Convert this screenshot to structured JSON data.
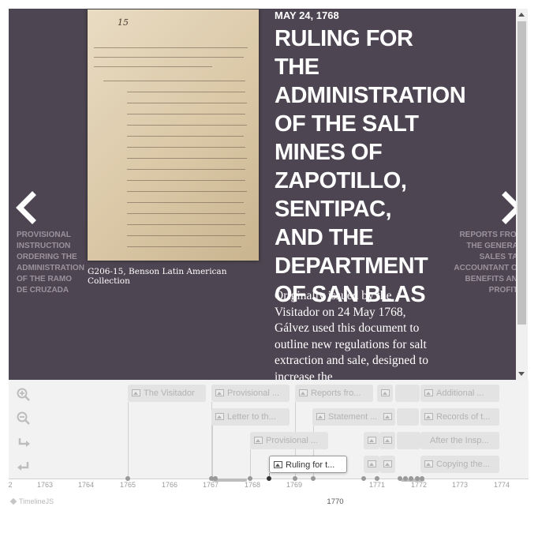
{
  "slide": {
    "date": "MAY 24, 1768",
    "headline": "RULING FOR THE ADMINISTRATION OF THE SALT MINES OF ZAPOTILLO, SENTIPAC, AND THE DEPARTMENT OF SAN BLAS",
    "body": "Originally issued by the Visitador on 24 May 1768, Gálvez used this document to outline new regulations for salt extraction and sale, designed to increase the",
    "media_caption": "G206-15, Benson Latin American Collection",
    "media_page_number": "15",
    "prev_label": "PROVISIONAL INSTRUCTION ORDERING THE ADMINISTRATION OF THE RAMO DE CRUZADA",
    "next_label": "REPORTS FROM THE GENERAL SALES TAX ACCOUNTANT ON BENEFITS AND PROFITS",
    "background_color": "#4d4551"
  },
  "icons": {
    "prev": "chevron-left-icon",
    "next": "chevron-right-icon",
    "zoom_in": "zoom-in-icon",
    "zoom_out": "zoom-out-icon",
    "undo": "undo-icon",
    "redo": "redo-icon",
    "marker_image": "image-icon"
  },
  "timenav": {
    "markers": [
      {
        "label": "The Visitador"
      },
      {
        "label": "Provisional ..."
      },
      {
        "label": "Reports fro..."
      },
      {
        "label": "Additional ..."
      },
      {
        "label": "Letter to th..."
      },
      {
        "label": "Statement ..."
      },
      {
        "label": "Records of t..."
      },
      {
        "label": "Provisional ..."
      },
      {
        "label": "After the Insp..."
      },
      {
        "label": "Ruling for t..."
      },
      {
        "label": "Copying the..."
      }
    ],
    "years": [
      "2",
      "1763",
      "1764",
      "1765",
      "1766",
      "1767",
      "1768",
      "1769",
      "1770",
      "1771",
      "1772",
      "1773",
      "1774"
    ],
    "major_year": "1770",
    "branding": "TimelineJS"
  }
}
